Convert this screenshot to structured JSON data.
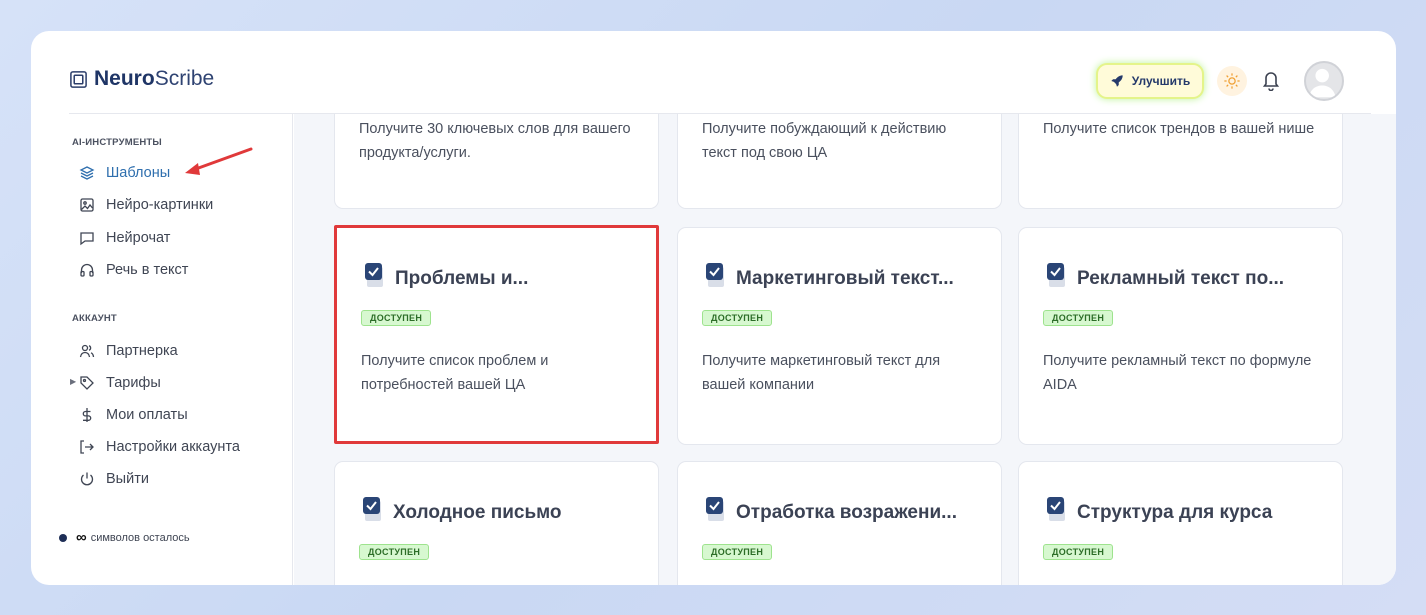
{
  "header": {
    "brand_bold": "Neuro",
    "brand_light": "Scribe",
    "upgrade_label": "Улучшить"
  },
  "sidebar": {
    "ai_section_title": "AI-ИНСТРУМЕНТЫ",
    "ai_items": [
      {
        "label": "Шаблоны",
        "icon": "layers-icon"
      },
      {
        "label": "Нейро-картинки",
        "icon": "image-icon"
      },
      {
        "label": "Нейрочат",
        "icon": "chat-icon"
      },
      {
        "label": "Речь в текст",
        "icon": "headphones-icon"
      }
    ],
    "account_section_title": "АККАУНТ",
    "account_items": [
      {
        "label": "Партнерка",
        "icon": "users-icon"
      },
      {
        "label": "Тарифы",
        "icon": "tag-icon"
      },
      {
        "label": "Мои оплаты",
        "icon": "dollar-icon"
      },
      {
        "label": "Настройки аккаунта",
        "icon": "logout-arrow-icon"
      },
      {
        "label": "Выйти",
        "icon": "power-icon"
      }
    ],
    "credits_symbol": "∞",
    "credits_label": "символов осталось"
  },
  "cards_top": [
    {
      "desc": "Получите 30 ключевых слов для вашего продукта/услуги."
    },
    {
      "desc": "Получите побуждающий к действию текст под свою ЦА"
    },
    {
      "desc": "Получите список трендов в вашей нише"
    }
  ],
  "cards_mid": [
    {
      "title": "Проблемы и...",
      "badge": "ДОСТУПЕН",
      "desc": "Получите список проблем и потребностей вашей ЦА"
    },
    {
      "title": "Маркетинговый текст...",
      "badge": "ДОСТУПЕН",
      "desc": "Получите маркетинговый текст для вашей компании"
    },
    {
      "title": "Рекламный текст по...",
      "badge": "ДОСТУПЕН",
      "desc": "Получите рекламный текст по формуле AIDA"
    }
  ],
  "cards_bottom": [
    {
      "title": "Холодное письмо",
      "badge": "ДОСТУПЕН"
    },
    {
      "title": "Отработка возражени...",
      "badge": "ДОСТУПЕН"
    },
    {
      "title": "Структура для курса",
      "badge": "ДОСТУПЕН"
    }
  ],
  "colors": {
    "accent": "#2f6fae",
    "highlight": "#e0393a",
    "badge_bg": "#d7f8d0"
  }
}
